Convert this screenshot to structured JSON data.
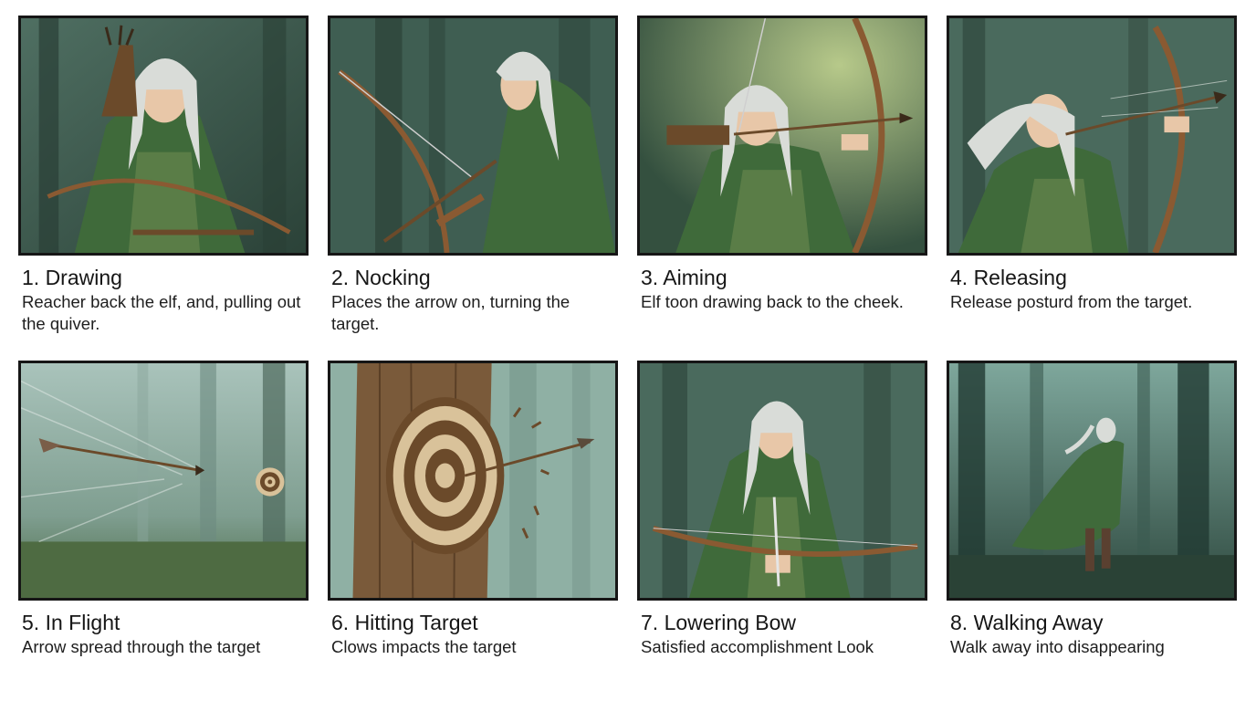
{
  "panels": [
    {
      "title": "1. Drawing",
      "caption": "Reacher back the elf, and, pulling out the quiver."
    },
    {
      "title": "2. Nocking",
      "caption": "Places the arrow on, turning the target."
    },
    {
      "title": "3. Aiming",
      "caption": "Elf toon drawing back to the cheek."
    },
    {
      "title": "4. Releasing",
      "caption": "Release posturd from the target."
    },
    {
      "title": "5. In Flight",
      "caption": "Arrow spread through the target"
    },
    {
      "title": "6. Hitting Target",
      "caption": "Clows impacts the target"
    },
    {
      "title": "7. Lowering Bow",
      "caption": "Satisfied accomplishment Look"
    },
    {
      "title": "8. Walking Away",
      "caption": "Walk away into disappearing"
    }
  ],
  "colors": {
    "cloak": "#3f6a3a",
    "tunic": "#5a7d47",
    "hair": "#d9dcd8",
    "skin": "#e8c7a8",
    "bow": "#8a5a32",
    "forest_dark": "#2f4a40",
    "forest_mist": "#8fb0a4",
    "target_light": "#d9c29a",
    "target_dark": "#6b4a2a"
  }
}
